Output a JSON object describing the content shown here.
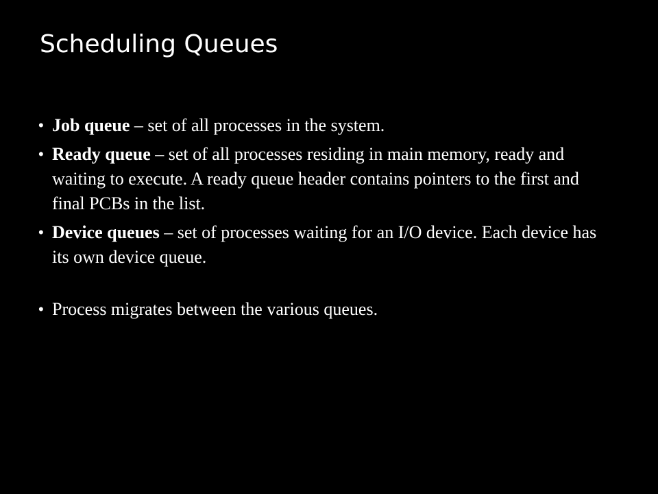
{
  "slide": {
    "title": "Scheduling Queues",
    "bullet_symbol": "•",
    "bullets": [
      {
        "term": "Job queue",
        "text": " – set of all processes in the system."
      },
      {
        "term": "Ready queue",
        "text": " – set of all processes residing in main memory, ready and waiting to execute. A ready queue header contains pointers to the first and final PCBs in the list."
      },
      {
        "term": "Device queues",
        "text": " – set of processes waiting for an I/O device. Each device has its own device queue."
      },
      {
        "term": "",
        "text": "Process migrates between the various queues."
      }
    ]
  },
  "colors": {
    "background": "#000000",
    "text": "#ffffff"
  }
}
